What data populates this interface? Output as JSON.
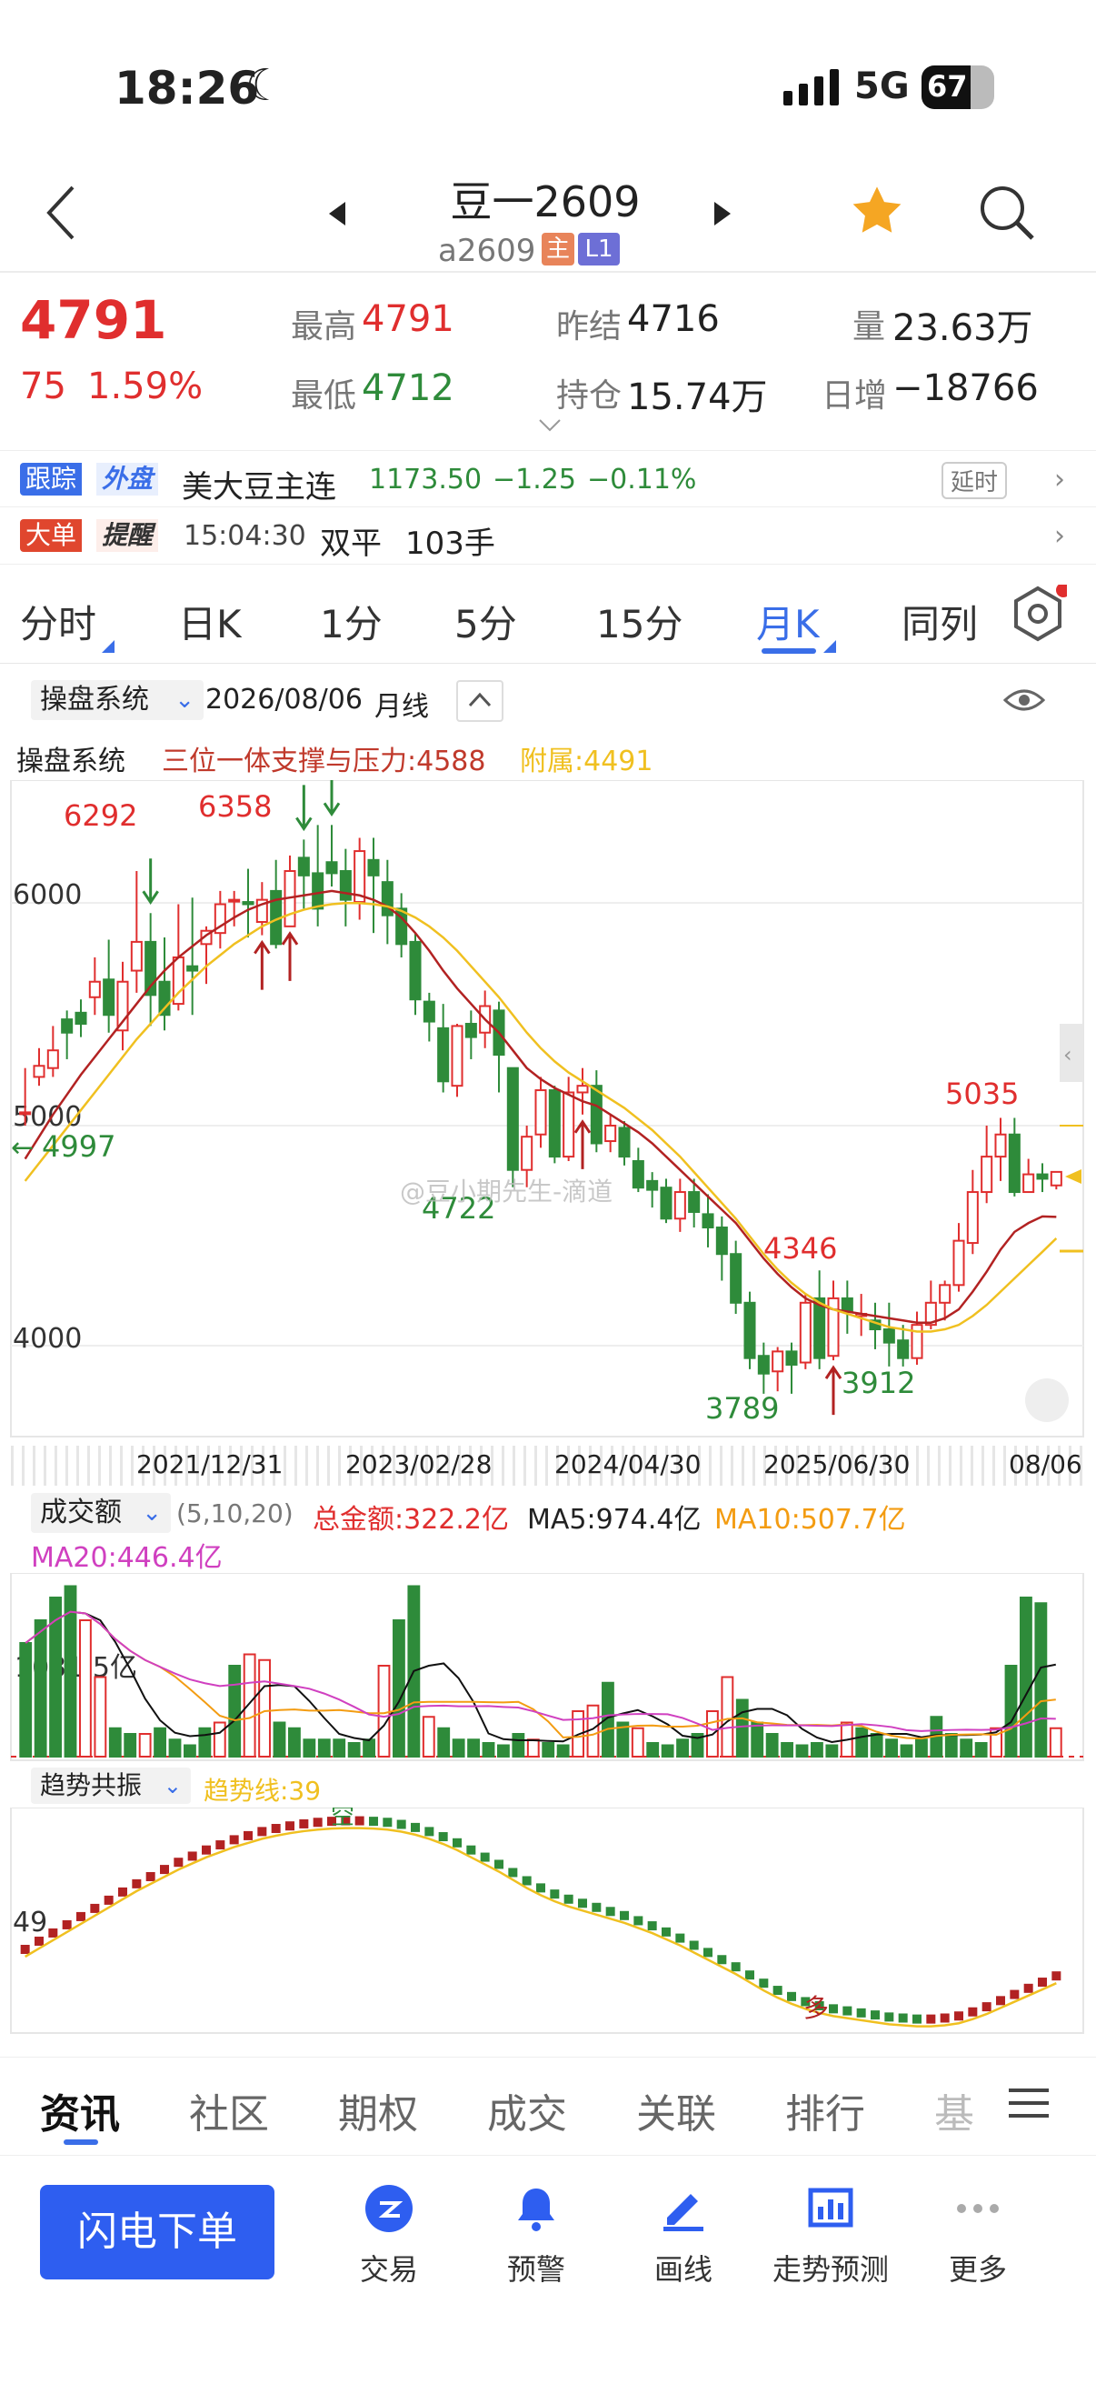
{
  "status_bar": {
    "time": "18:26",
    "network": "5G",
    "battery": "67"
  },
  "nav": {
    "title": "豆一2609",
    "code": "a2609",
    "badge_main": "主",
    "badge_level": "L1"
  },
  "quote": {
    "price": "4791",
    "change": "75",
    "change_pct": "1.59%",
    "high_label": "最高",
    "high": "4791",
    "low_label": "最低",
    "low": "4712",
    "prev_label": "昨结",
    "prev": "4716",
    "oi_label": "持仓",
    "oi": "15.74万",
    "vol_label": "量",
    "vol": "23.63万",
    "daily_label": "日增",
    "daily": "−18766"
  },
  "banner1": {
    "tag1": "跟踪",
    "tag2": "外盘",
    "name": "美大豆主连",
    "price": "1173.50",
    "chg": "−1.25",
    "pct": "−0.11%",
    "delay": "延时"
  },
  "banner2": {
    "tag1": "大单",
    "tag2": "提醒",
    "time": "15:04:30",
    "type": "双平",
    "qty": "103手"
  },
  "tabs": [
    "分时",
    "日K",
    "1分",
    "5分",
    "15分",
    "月K",
    "同列"
  ],
  "chart_header": {
    "system": "操盘系统",
    "date": "2026/08/06",
    "period": "月线",
    "legend_name": "操盘系统",
    "legend_sr": "三位一体支撑与压力:4588",
    "legend_aux": "附属:4491"
  },
  "chart_labels": {
    "h1": "6292",
    "h2": "6358",
    "p4997": "4997",
    "p4722": "4722",
    "p4346": "4346",
    "p3789": "3789",
    "p3912": "3912",
    "p5035": "5035",
    "watermark": "@豆小期先生-滴道"
  },
  "chart_data": [
    {
      "type": "candlestick",
      "y_ticks": [
        "6000",
        "5000",
        "4000"
      ],
      "x_ticks": [
        "2021/12/31",
        "2023/02/28",
        "2024/04/30",
        "2025/06/30",
        "08/06"
      ],
      "ylim": [
        3700,
        6400
      ],
      "values": [
        [
          5060,
          5060,
          5260,
          5000
        ],
        [
          5220,
          5270,
          5350,
          5180
        ],
        [
          5260,
          5340,
          5450,
          5220
        ],
        [
          5480,
          5420,
          5520,
          5300
        ],
        [
          5510,
          5460,
          5570,
          5400
        ],
        [
          5580,
          5650,
          5760,
          5500
        ],
        [
          5660,
          5500,
          5840,
          5420
        ],
        [
          5430,
          5650,
          5740,
          5340
        ],
        [
          5700,
          5830,
          6150,
          5600
        ],
        [
          5830,
          5590,
          5960,
          5450
        ],
        [
          5650,
          5500,
          5850,
          5430
        ],
        [
          5550,
          5760,
          6000,
          5520
        ],
        [
          5720,
          5700,
          6030,
          5500
        ],
        [
          5820,
          5880,
          5900,
          5640
        ],
        [
          5870,
          6000,
          6060,
          5800
        ],
        [
          6020,
          6020,
          6060,
          5900
        ],
        [
          6010,
          6000,
          6160,
          5850
        ],
        [
          5920,
          6020,
          6100,
          5860
        ],
        [
          6060,
          5820,
          6200,
          5800
        ],
        [
          5900,
          6150,
          6220,
          5900
        ],
        [
          6210,
          6130,
          6292,
          5980
        ],
        [
          6140,
          5980,
          6358,
          5900
        ],
        [
          6190,
          6140,
          6358,
          6080
        ],
        [
          6150,
          6020,
          6250,
          5900
        ],
        [
          6010,
          6240,
          6300,
          5930
        ],
        [
          6200,
          6130,
          6300,
          5870
        ],
        [
          6100,
          5950,
          6200,
          5820
        ],
        [
          5980,
          5820,
          6050,
          5760
        ],
        [
          5830,
          5570,
          5870,
          5500
        ],
        [
          5560,
          5470,
          5600,
          5380
        ],
        [
          5440,
          5200,
          5550,
          5150
        ],
        [
          5180,
          5450,
          5460,
          5130
        ],
        [
          5460,
          5400,
          5520,
          5300
        ],
        [
          5420,
          5540,
          5610,
          5350
        ],
        [
          5520,
          5320,
          5560,
          5150
        ],
        [
          5260,
          4800,
          5260,
          4722
        ],
        [
          4800,
          4950,
          5000,
          4722
        ],
        [
          4960,
          5160,
          5220,
          4900
        ],
        [
          5160,
          4860,
          5180,
          4830
        ],
        [
          4860,
          5150,
          5220,
          4840
        ],
        [
          5150,
          5180,
          5260,
          5050
        ],
        [
          5180,
          4920,
          5250,
          4880
        ],
        [
          4930,
          5000,
          5050,
          4880
        ],
        [
          4990,
          4860,
          5020,
          4820
        ],
        [
          4840,
          4720,
          4900,
          4700
        ],
        [
          4750,
          4710,
          4790,
          4630
        ],
        [
          4720,
          4580,
          4760,
          4560
        ],
        [
          4580,
          4700,
          4760,
          4520
        ],
        [
          4700,
          4610,
          4760,
          4540
        ],
        [
          4600,
          4540,
          4690,
          4450
        ],
        [
          4540,
          4420,
          4590,
          4300
        ],
        [
          4420,
          4200,
          4480,
          4150
        ],
        [
          4200,
          3950,
          4250,
          3900
        ],
        [
          3960,
          3880,
          4020,
          3789
        ],
        [
          3890,
          3980,
          4000,
          3800
        ],
        [
          3980,
          3920,
          4020,
          3789
        ],
        [
          3930,
          4200,
          4240,
          3900
        ],
        [
          4220,
          3950,
          4346,
          3900
        ],
        [
          3960,
          4220,
          4300,
          3940
        ],
        [
          4220,
          4160,
          4300,
          4060
        ],
        [
          4140,
          4150,
          4240,
          4050
        ],
        [
          4120,
          4080,
          4200,
          3990
        ],
        [
          4080,
          4020,
          4200,
          3912
        ],
        [
          4030,
          3950,
          4100,
          3912
        ],
        [
          3950,
          4100,
          4160,
          3920
        ],
        [
          4100,
          4200,
          4300,
          4080
        ],
        [
          4200,
          4280,
          4300,
          4120
        ],
        [
          4280,
          4480,
          4560,
          4250
        ],
        [
          4470,
          4700,
          4800,
          4420
        ],
        [
          4700,
          4860,
          5000,
          4650
        ],
        [
          4860,
          4960,
          5035,
          4750
        ],
        [
          4960,
          4700,
          5035,
          4680
        ],
        [
          4700,
          4780,
          4850,
          4720
        ],
        [
          4780,
          4760,
          4830,
          4700
        ],
        [
          4730,
          4791,
          4791,
          4712
        ]
      ],
      "ma_short": [
        4850,
        4950,
        5050,
        5140,
        5230,
        5310,
        5390,
        5470,
        5550,
        5630,
        5700,
        5760,
        5810,
        5860,
        5900,
        5940,
        5975,
        6000,
        6020,
        6030,
        6040,
        6050,
        6060,
        6050,
        6040,
        6020,
        5990,
        5940,
        5870,
        5790,
        5700,
        5620,
        5550,
        5480,
        5420,
        5340,
        5260,
        5210,
        5170,
        5140,
        5110,
        5090,
        5050,
        5010,
        4970,
        4920,
        4860,
        4800,
        4740,
        4680,
        4620,
        4560,
        4480,
        4400,
        4330,
        4270,
        4220,
        4190,
        4170,
        4160,
        4150,
        4140,
        4130,
        4120,
        4110,
        4110,
        4130,
        4170,
        4250,
        4340,
        4440,
        4520,
        4560,
        4590,
        4588
      ],
      "ma_long": [
        4750,
        4830,
        4910,
        4990,
        5070,
        5150,
        5230,
        5310,
        5390,
        5460,
        5530,
        5600,
        5660,
        5720,
        5770,
        5820,
        5860,
        5900,
        5930,
        5955,
        5975,
        5990,
        6000,
        6005,
        6005,
        6000,
        5990,
        5970,
        5940,
        5900,
        5850,
        5790,
        5720,
        5650,
        5580,
        5500,
        5420,
        5350,
        5290,
        5240,
        5200,
        5160,
        5120,
        5080,
        5030,
        4980,
        4920,
        4860,
        4790,
        4720,
        4650,
        4580,
        4500,
        4420,
        4350,
        4290,
        4240,
        4200,
        4170,
        4150,
        4130,
        4110,
        4090,
        4080,
        4070,
        4070,
        4080,
        4100,
        4140,
        4190,
        4250,
        4310,
        4370,
        4430,
        4491
      ],
      "colors": {
        "up": "#e02e2e",
        "down": "#2e8b3a",
        "ma_short": "#b22222",
        "ma_long": "#f0c020"
      }
    },
    {
      "type": "bar",
      "title": "成交额",
      "params": "(5,10,20)",
      "total": "总金额:322.2亿",
      "ma5": "MA5:974.4亿",
      "ma10": "MA10:507.7亿",
      "ma20": "MA20:446.4亿",
      "y_tick": "1031.5亿",
      "ylim": [
        0,
        1600
      ],
      "values": [
        [
          1000,
          0
        ],
        [
          1200,
          0
        ],
        [
          1400,
          0
        ],
        [
          1500,
          0
        ],
        [
          1200,
          1
        ],
        [
          700,
          1
        ],
        [
          250,
          0
        ],
        [
          200,
          0
        ],
        [
          200,
          1
        ],
        [
          250,
          0
        ],
        [
          150,
          0
        ],
        [
          100,
          0
        ],
        [
          250,
          0
        ],
        [
          300,
          1
        ],
        [
          800,
          0
        ],
        [
          900,
          1
        ],
        [
          850,
          1
        ],
        [
          300,
          0
        ],
        [
          250,
          0
        ],
        [
          150,
          0
        ],
        [
          150,
          0
        ],
        [
          150,
          0
        ],
        [
          120,
          0
        ],
        [
          150,
          0
        ],
        [
          800,
          1
        ],
        [
          1200,
          0
        ],
        [
          1500,
          0
        ],
        [
          350,
          1
        ],
        [
          250,
          0
        ],
        [
          150,
          0
        ],
        [
          150,
          0
        ],
        [
          120,
          0
        ],
        [
          100,
          0
        ],
        [
          200,
          0
        ],
        [
          150,
          1
        ],
        [
          120,
          0
        ],
        [
          100,
          0
        ],
        [
          400,
          1
        ],
        [
          450,
          1
        ],
        [
          650,
          0
        ],
        [
          300,
          0
        ],
        [
          250,
          1
        ],
        [
          120,
          0
        ],
        [
          100,
          0
        ],
        [
          150,
          0
        ],
        [
          200,
          0
        ],
        [
          400,
          1
        ],
        [
          700,
          1
        ],
        [
          500,
          0
        ],
        [
          300,
          0
        ],
        [
          200,
          0
        ],
        [
          120,
          0
        ],
        [
          100,
          0
        ],
        [
          120,
          0
        ],
        [
          100,
          0
        ],
        [
          300,
          1
        ],
        [
          250,
          0
        ],
        [
          200,
          0
        ],
        [
          150,
          0
        ],
        [
          100,
          0
        ],
        [
          150,
          0
        ],
        [
          350,
          0
        ],
        [
          200,
          0
        ],
        [
          150,
          0
        ],
        [
          120,
          0
        ],
        [
          250,
          1
        ],
        [
          800,
          0
        ],
        [
          1400,
          0
        ],
        [
          1350,
          0
        ],
        [
          250,
          1
        ]
      ],
      "colors": {
        "ma5": "#111111",
        "ma10": "#f39c12",
        "ma20": "#d040c0"
      }
    },
    {
      "type": "line",
      "title": "趋势共振",
      "trend_line": "趋势线:39",
      "y_tick": "49",
      "markers": [
        "空",
        "多"
      ],
      "colors": {
        "trend_line": "#f0c020",
        "up": "#b22222",
        "down": "#2e8b3a"
      }
    }
  ],
  "bottom_tabs": [
    "资讯",
    "社区",
    "期权",
    "成交",
    "关联",
    "排行",
    "基"
  ],
  "bottom_bar": {
    "order_button": "闪电下单",
    "items": [
      "交易",
      "预警",
      "画线",
      "走势预测",
      "更多"
    ]
  }
}
